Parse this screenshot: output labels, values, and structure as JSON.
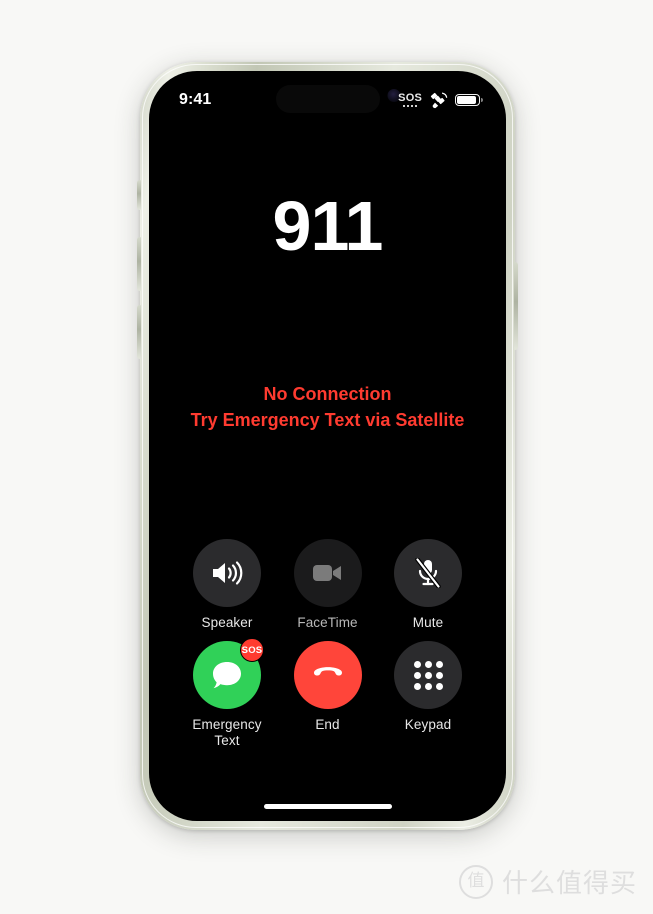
{
  "device": {
    "frame_color": "#d8dccd",
    "screen_background": "#000000",
    "hardware": {
      "action_button": "action-button",
      "volume_up": "volume-up-button",
      "volume_down": "volume-down-button",
      "power": "power-button"
    }
  },
  "status_bar": {
    "time": "9:41",
    "sos_label": "SOS",
    "signal_dots": 4,
    "satellite_icon": "satellite-icon",
    "battery_icon": "battery-icon",
    "battery_level_percent": 100
  },
  "call": {
    "number": "911",
    "status_line_1": "No Connection",
    "status_line_2": "Try Emergency Text via Satellite",
    "status_color": "#ff3b30"
  },
  "controls": {
    "rows": [
      [
        {
          "id": "speaker",
          "label": "Speaker",
          "icon": "speaker-wave-icon",
          "state": "enabled",
          "style": "dark",
          "circle_color": "#2b2b2d"
        },
        {
          "id": "facetime",
          "label": "FaceTime",
          "icon": "video-camera-icon",
          "state": "disabled",
          "style": "dimmed",
          "circle_color": "#1b1b1c"
        },
        {
          "id": "mute",
          "label": "Mute",
          "icon": "microphone-slash-icon",
          "state": "enabled",
          "style": "dark",
          "circle_color": "#2b2b2d"
        }
      ],
      [
        {
          "id": "emergency-text",
          "label": "Emergency Text",
          "label_line_1": "Emergency",
          "label_line_2": "Text",
          "icon": "message-bubble-icon",
          "state": "enabled",
          "style": "green",
          "circle_color": "#30d158",
          "badge": "SOS",
          "badge_color": "#ff3b30"
        },
        {
          "id": "end",
          "label": "End",
          "icon": "end-call-handset-icon",
          "state": "enabled",
          "style": "red",
          "circle_color": "#ff453a"
        },
        {
          "id": "keypad",
          "label": "Keypad",
          "icon": "keypad-dots-icon",
          "state": "enabled",
          "style": "dark",
          "circle_color": "#2b2b2d"
        }
      ]
    ]
  },
  "home_indicator": "home-indicator",
  "watermark": {
    "badge": "值",
    "text": "什么值得买"
  }
}
